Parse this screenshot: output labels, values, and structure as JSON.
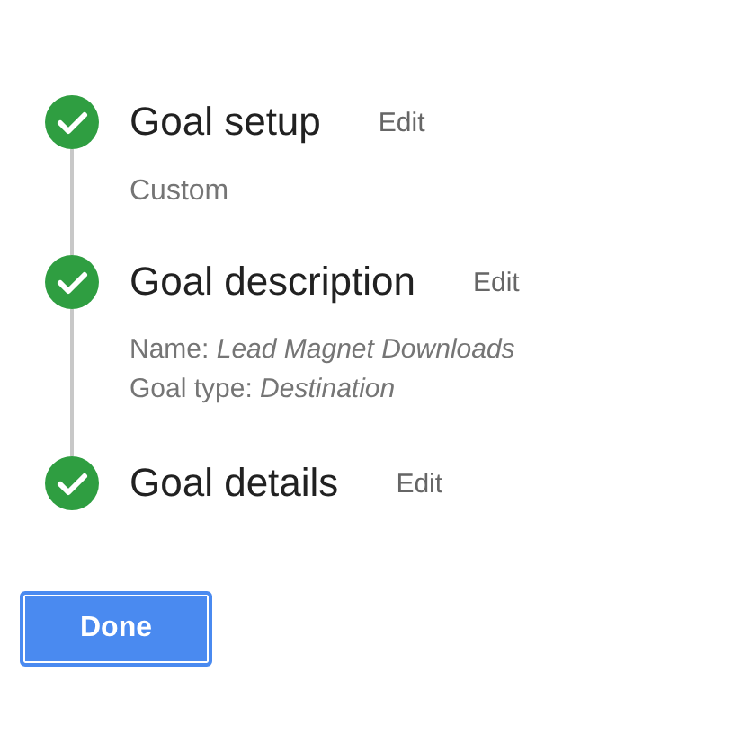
{
  "steps": [
    {
      "title": "Goal setup",
      "completed": true,
      "edit": "Edit",
      "details": [
        "Custom"
      ]
    },
    {
      "title": "Goal description",
      "completed": true,
      "edit": "Edit",
      "details": [
        "Name: *Lead Magnet Downloads*",
        "Goal type: *Destination*"
      ]
    },
    {
      "title": "Goal details",
      "completed": true,
      "edit": "Edit"
    }
  ],
  "done_button": "Done"
}
